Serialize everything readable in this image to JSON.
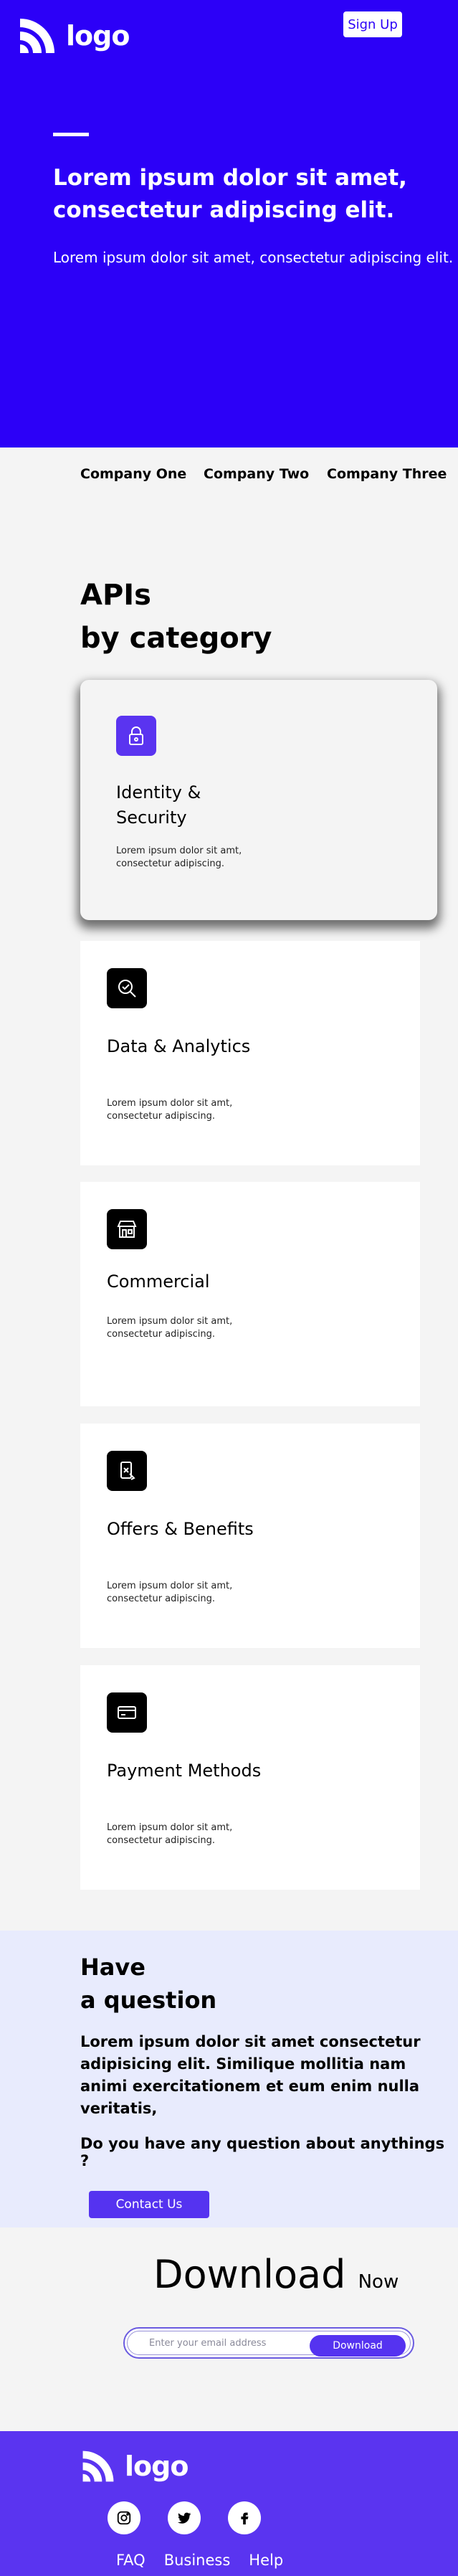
{
  "header": {
    "logo_text": "logo",
    "signup_label": "Sign Up"
  },
  "hero": {
    "title": "Lorem ipsum dolor sit amet, consectetur adipiscing elit.",
    "subtitle": "Lorem ipsum dolor sit amet, consectetur adipiscing elit."
  },
  "companies": [
    "Company One",
    "Company Two",
    "Company Three"
  ],
  "apis": {
    "title_line1": "APIs",
    "title_line2": "by category",
    "cards": [
      {
        "title": "Identity & Security",
        "desc": "Lorem ipsum dolor sit amt, consectetur adipiscing.",
        "icon": "lock-icon"
      },
      {
        "title": "Data & Analytics",
        "desc": "Lorem ipsum dolor sit amt, consectetur adipiscing.",
        "icon": "analytics-icon"
      },
      {
        "title": "Commercial",
        "desc": "Lorem ipsum dolor sit amt, consectetur adipiscing.",
        "icon": "store-icon"
      },
      {
        "title": "Offers & Benefits",
        "desc": "Lorem ipsum dolor sit amt, consectetur adipiscing.",
        "icon": "offers-icon"
      },
      {
        "title": "Payment Methods",
        "desc": "Lorem ipsum dolor sit amt, consectetur adipiscing.",
        "icon": "credit-card-icon"
      }
    ]
  },
  "question": {
    "title_line1": "Have",
    "title_line2": "a question",
    "text": "Lorem ipsum dolor sit amet consectetur adipisicing elit. Similique mollitia nam animi exercitationem et eum enim nulla veritatis,",
    "ask": "Do you have any question about anythings ?",
    "contact_label": "Contact Us"
  },
  "download": {
    "title": "Download",
    "title_suffix": "Now",
    "email_placeholder": "Enter your email address",
    "button_label": "Download"
  },
  "footer": {
    "logo_text": "logo",
    "socials": [
      "instagram-icon",
      "twitter-icon",
      "facebook-icon"
    ],
    "links": [
      "FAQ",
      "Business",
      "Help"
    ]
  },
  "colors": {
    "hero_bg": "#2c00f7",
    "accent": "#5533f0",
    "question_bg": "#e8ebfd",
    "page_bg": "#f4f4f4"
  }
}
